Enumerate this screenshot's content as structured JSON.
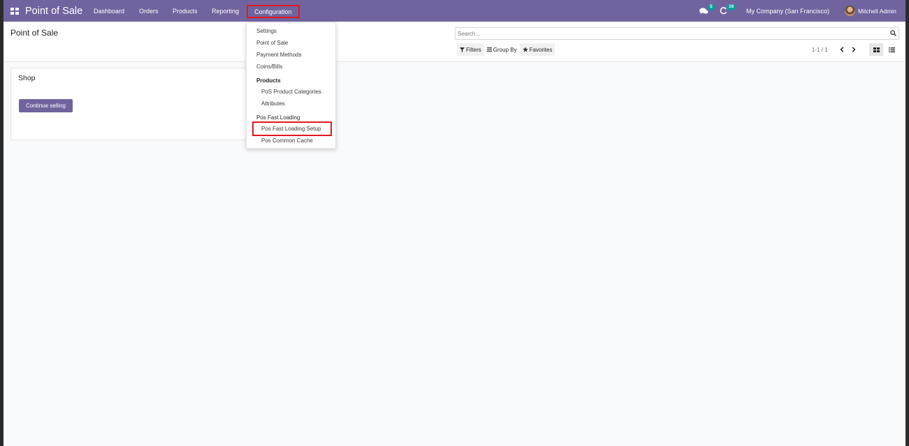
{
  "navbar": {
    "brand": "Point of Sale",
    "items": [
      "Dashboard",
      "Orders",
      "Products",
      "Reporting",
      "Configuration"
    ],
    "chat_count": "5",
    "activity_count": "16",
    "company": "My Company (San Francisco)",
    "user": "Mitchell Admin"
  },
  "control_panel": {
    "title": "Point of Sale",
    "search_placeholder": "Search...",
    "filters_label": "Filters",
    "group_by_label": "Group By",
    "favorites_label": "Favorites",
    "pager": "1-1 / 1"
  },
  "card": {
    "title": "Shop",
    "button": "Continue selling"
  },
  "dropdown": {
    "items": [
      "Settings",
      "Point of Sale",
      "Payment Methods",
      "Coins/Bills"
    ],
    "products_header": "Products",
    "products_items": [
      "PoS Product Categories",
      "Attributes"
    ],
    "fast_loading_header": "Pos Fast Loading",
    "fast_loading_items": [
      "Pos Fast Loading Setup",
      "Pos Common Cache"
    ]
  },
  "colors": {
    "brand": "#71639e",
    "badge": "#00a09d",
    "highlight": "#e0191f"
  }
}
